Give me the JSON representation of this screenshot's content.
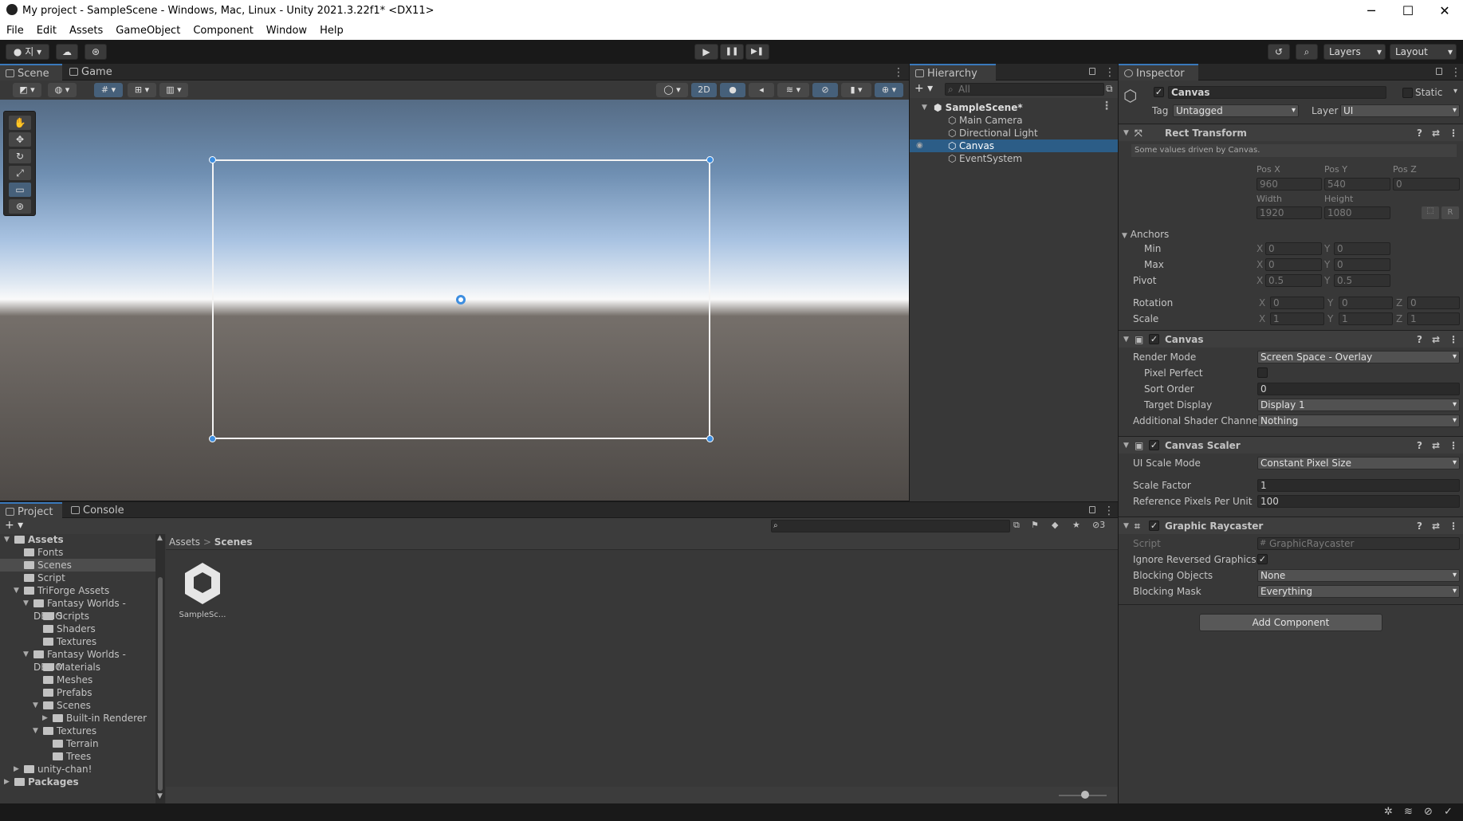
{
  "window": {
    "title": "My project - SampleScene - Windows, Mac, Linux - Unity 2021.3.22f1* <DX11>",
    "minimize": "─",
    "maximize": "☐",
    "close": "✕"
  },
  "menu": [
    "File",
    "Edit",
    "Assets",
    "GameObject",
    "Component",
    "Window",
    "Help"
  ],
  "toolbar": {
    "account_label": "지",
    "layers_label": "Layers",
    "layout_label": "Layout",
    "play": "▶",
    "pause": "❚❚",
    "step": "▶❚"
  },
  "scene_panel": {
    "tabs": [
      "Scene",
      "Game"
    ],
    "mode_2d": "2D"
  },
  "hierarchy": {
    "tab": "Hierarchy",
    "search_placeholder": "All",
    "scene": "SampleScene*",
    "items": [
      "Main Camera",
      "Directional Light",
      "Canvas",
      "EventSystem"
    ],
    "selected_index": 2
  },
  "inspector": {
    "tab": "Inspector",
    "object_name": "Canvas",
    "static_label": "Static",
    "tag_label": "Tag",
    "tag_value": "Untagged",
    "layer_label": "Layer",
    "layer_value": "UI",
    "rect_transform": {
      "title": "Rect Transform",
      "note": "Some values driven by Canvas.",
      "posx_label": "Pos X",
      "posy_label": "Pos Y",
      "posz_label": "Pos Z",
      "posx": "960",
      "posy": "540",
      "posz": "0",
      "width_label": "Width",
      "height_label": "Height",
      "width": "1920",
      "height": "1080",
      "r_label": "R",
      "anchors": "Anchors",
      "min": "Min",
      "max": "Max",
      "pivot": "Pivot",
      "rotation": "Rotation",
      "scale": "Scale",
      "x": "X",
      "y": "Y",
      "z": "Z",
      "min_x": "0",
      "min_y": "0",
      "max_x": "0",
      "max_y": "0",
      "pivot_x": "0.5",
      "pivot_y": "0.5",
      "rot_x": "0",
      "rot_y": "0",
      "rot_z": "0",
      "scale_x": "1",
      "scale_y": "1",
      "scale_z": "1"
    },
    "canvas": {
      "title": "Canvas",
      "render_mode_label": "Render Mode",
      "render_mode": "Screen Space - Overlay",
      "pixel_perfect_label": "Pixel Perfect",
      "sort_order_label": "Sort Order",
      "sort_order": "0",
      "target_display_label": "Target Display",
      "target_display": "Display 1",
      "shader_channels_label": "Additional Shader Channels",
      "shader_channels": "Nothing"
    },
    "canvas_scaler": {
      "title": "Canvas Scaler",
      "ui_scale_mode_label": "UI Scale Mode",
      "ui_scale_mode": "Constant Pixel Size",
      "scale_factor_label": "Scale Factor",
      "scale_factor": "1",
      "ref_ppu_label": "Reference Pixels Per Unit",
      "ref_ppu": "100"
    },
    "graphic_raycaster": {
      "title": "Graphic Raycaster",
      "script_label": "Script",
      "script": "GraphicRaycaster",
      "ignore_reversed_label": "Ignore Reversed Graphics",
      "blocking_objects_label": "Blocking Objects",
      "blocking_objects": "None",
      "blocking_mask_label": "Blocking Mask",
      "blocking_mask": "Everything"
    },
    "add_component": "Add Component",
    "help": "?",
    "settings": "⇄",
    "more": "⋮",
    "check": "✓"
  },
  "project": {
    "tabs": [
      "Project",
      "Console"
    ],
    "breadcrumb_root": "Assets",
    "breadcrumb_sep": ">",
    "breadcrumb_current": "Scenes",
    "hidden_count": "3",
    "asset_name": "SampleSc...",
    "tree": [
      {
        "label": "Assets",
        "depth": 0,
        "expanded": true,
        "bold": true
      },
      {
        "label": "Fonts",
        "depth": 1
      },
      {
        "label": "Scenes",
        "depth": 1,
        "selected": true
      },
      {
        "label": "Script",
        "depth": 1
      },
      {
        "label": "TriForge Assets",
        "depth": 1,
        "expanded": true
      },
      {
        "label": "Fantasy Worlds - DEMO",
        "depth": 2,
        "expanded": true
      },
      {
        "label": "Scripts",
        "depth": 3
      },
      {
        "label": "Shaders",
        "depth": 3
      },
      {
        "label": "Textures",
        "depth": 3
      },
      {
        "label": "Fantasy Worlds - DEMO",
        "depth": 2,
        "expanded": true
      },
      {
        "label": "Materials",
        "depth": 3
      },
      {
        "label": "Meshes",
        "depth": 3
      },
      {
        "label": "Prefabs",
        "depth": 3
      },
      {
        "label": "Scenes",
        "depth": 3,
        "expanded": true
      },
      {
        "label": "Built-in Renderer",
        "depth": 4,
        "collapsed": true
      },
      {
        "label": "Textures",
        "depth": 3,
        "expanded": true
      },
      {
        "label": "Terrain",
        "depth": 4
      },
      {
        "label": "Trees",
        "depth": 4
      },
      {
        "label": "unity-chan!",
        "depth": 1,
        "collapsed": true
      },
      {
        "label": "Packages",
        "depth": 0,
        "collapsed": true,
        "bold": true
      }
    ]
  }
}
